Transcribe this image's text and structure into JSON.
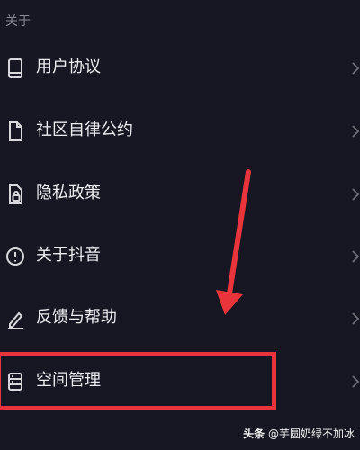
{
  "section": {
    "title": "关于"
  },
  "menu": {
    "items": [
      {
        "label": "用户协议",
        "icon": "book-icon"
      },
      {
        "label": "社区自律公约",
        "icon": "document-icon"
      },
      {
        "label": "隐私政策",
        "icon": "privacy-lock-icon"
      },
      {
        "label": "关于抖音",
        "icon": "info-circle-icon"
      },
      {
        "label": "反馈与帮助",
        "icon": "pencil-icon"
      },
      {
        "label": "空间管理",
        "icon": "storage-icon"
      }
    ]
  },
  "annotation": {
    "highlighted_item": "空间管理",
    "color": "#e8343a"
  },
  "watermark": {
    "prefix": "头条",
    "text": "@芋圆奶绿不加冰"
  },
  "colors": {
    "background": "#161722",
    "text": "#ececf1",
    "muted": "#8a8b94",
    "accent": "#e8343a"
  }
}
